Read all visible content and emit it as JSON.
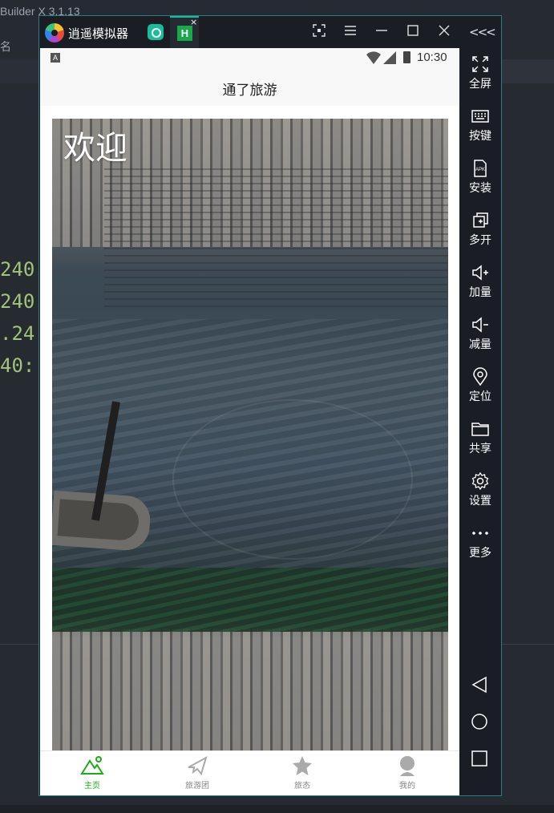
{
  "ide": {
    "title": "Builder X 3.1.13",
    "name_label": "名",
    "code_lines": [
      "240",
      "240",
      ".24",
      "40:"
    ]
  },
  "emulator": {
    "title": "逍遥模拟器",
    "tab_badge": "H",
    "tab_close": "×",
    "collapse_label": "<<<",
    "side_tools": [
      {
        "label": "全屏",
        "icon": "fullscreen-icon"
      },
      {
        "label": "按键",
        "icon": "keyboard-icon"
      },
      {
        "label": "安装",
        "icon": "apk-install-icon"
      },
      {
        "label": "多开",
        "icon": "multi-instance-icon"
      },
      {
        "label": "加量",
        "icon": "volume-up-icon"
      },
      {
        "label": "减量",
        "icon": "volume-down-icon"
      },
      {
        "label": "定位",
        "icon": "location-icon"
      },
      {
        "label": "共享",
        "icon": "folder-icon"
      },
      {
        "label": "设置",
        "icon": "gear-icon"
      },
      {
        "label": "更多",
        "icon": "more-icon"
      }
    ]
  },
  "phone": {
    "status_icon": "A",
    "time": "10:30",
    "nav_title": "通了旅游",
    "hero_text": "欢迎",
    "tabs": [
      {
        "label": "主页",
        "icon": "mountain-icon",
        "active": true
      },
      {
        "label": "旅游团",
        "icon": "plane-icon",
        "active": false
      },
      {
        "label": "旅态",
        "icon": "star-icon",
        "active": false
      },
      {
        "label": "我的",
        "icon": "user-icon",
        "active": false
      }
    ],
    "accent_color": "#1aad19"
  }
}
